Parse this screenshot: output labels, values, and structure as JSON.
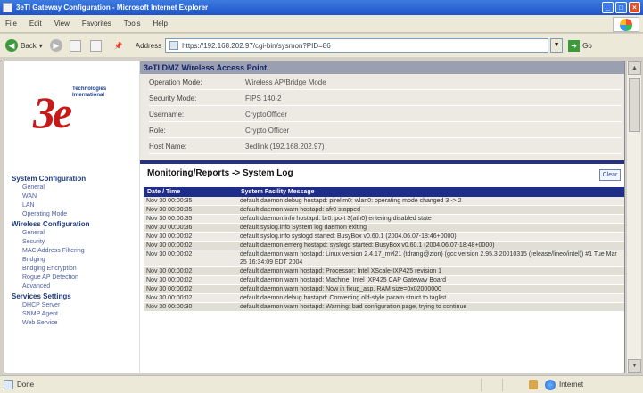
{
  "window": {
    "title": "3eTI Gateway Configuration - Microsoft Internet Explorer"
  },
  "menu": [
    "File",
    "Edit",
    "View",
    "Favorites",
    "Tools",
    "Help"
  ],
  "toolbar": {
    "back_label": "Back",
    "address_label": "Address",
    "address_value": "https://192.168.202.97/cgi-bin/sysmon?PID=86",
    "go_label": "Go"
  },
  "logo": {
    "mark": "3e",
    "tagline_1": "Technologies",
    "tagline_2": "International"
  },
  "sidebar": {
    "sections": [
      {
        "title": "System Configuration",
        "items": [
          "General",
          "WAN",
          "LAN",
          "Operating Mode"
        ]
      },
      {
        "title": "Wireless Configuration",
        "items": [
          "General",
          "Security",
          "MAC Address Filtering",
          "Bridging",
          "Bridging Encryption",
          "Rogue AP Detection",
          "Advanced"
        ]
      },
      {
        "title": "Services Settings",
        "items": [
          "DHCP Server",
          "SNMP Agent",
          "Web Service"
        ]
      }
    ]
  },
  "ap": {
    "header": "3eTI DMZ Wireless Access Point",
    "rows": [
      {
        "label": "Operation Mode:",
        "value": "Wireless AP/Bridge Mode"
      },
      {
        "label": "Security Mode:",
        "value": "FIPS 140-2"
      },
      {
        "label": "Username:",
        "value": "CryptoOfficer"
      },
      {
        "label": "Role:",
        "value": "Crypto Officer"
      },
      {
        "label": "Host Name:",
        "value": "3edlink (192.168.202.97)"
      }
    ]
  },
  "log": {
    "title": "Monitoring/Reports -> System Log",
    "clear_label": "Clear",
    "columns": [
      "Date / Time",
      "System Facility Message"
    ],
    "entries": [
      {
        "time": "Nov 30 00:00:35",
        "msg": "default daemon.debug hostapd: pirelim0: wlan0: operating mode changed 3 -> 2"
      },
      {
        "time": "Nov 30 00:00:35",
        "msg": "default daemon.warn hostapd: afr0 stopped"
      },
      {
        "time": "Nov 30 00:00:35",
        "msg": "default daemon.info hostapd: br0: port 3(ath0) entering disabled state"
      },
      {
        "time": "Nov 30 00:00:36",
        "msg": "default syslog.info System log daemon exiting"
      },
      {
        "time": "Nov 30 00:00:02",
        "msg": "default syslog.info syslogd started: BusyBox v0.60.1 (2004.06.07-18:46+0000)"
      },
      {
        "time": "Nov 30 00:00:02",
        "msg": "default daemon.emerg hostapd: syslogd started: BusyBox v0.60.1 (2004.06.07-18:48+0000)"
      },
      {
        "time": "Nov 30 00:00:02",
        "msg": "default daemon.warn hostapd: Linux version 2.4.17_mvl21 (tdrang@zion) (gcc version 2.95.3 20010315 (release/lineo/intel)) #1 Tue Mar 25 16:34:09 EDT 2004"
      },
      {
        "time": "Nov 30 00:00:02",
        "msg": "default daemon.warn hostapd: Processor: Intel XScale-IXP425 revision 1"
      },
      {
        "time": "Nov 30 00:00:02",
        "msg": "default daemon.warn hostapd: Machine: Intel IXP425 CAP Gateway Board"
      },
      {
        "time": "Nov 30 00:00:02",
        "msg": "default daemon.warn hostapd: Now in fixup_asp, RAM size=0x02000000"
      },
      {
        "time": "Nov 30 00:00:02",
        "msg": "default daemon.debug hostapd: Converting old-style param struct to taglist"
      },
      {
        "time": "Nov 30 00:00:30",
        "msg": "default daemon.warn hostapd: Warning: bad configuration page, trying to continue"
      }
    ]
  },
  "status": {
    "text": "Done",
    "zone": "Internet"
  }
}
